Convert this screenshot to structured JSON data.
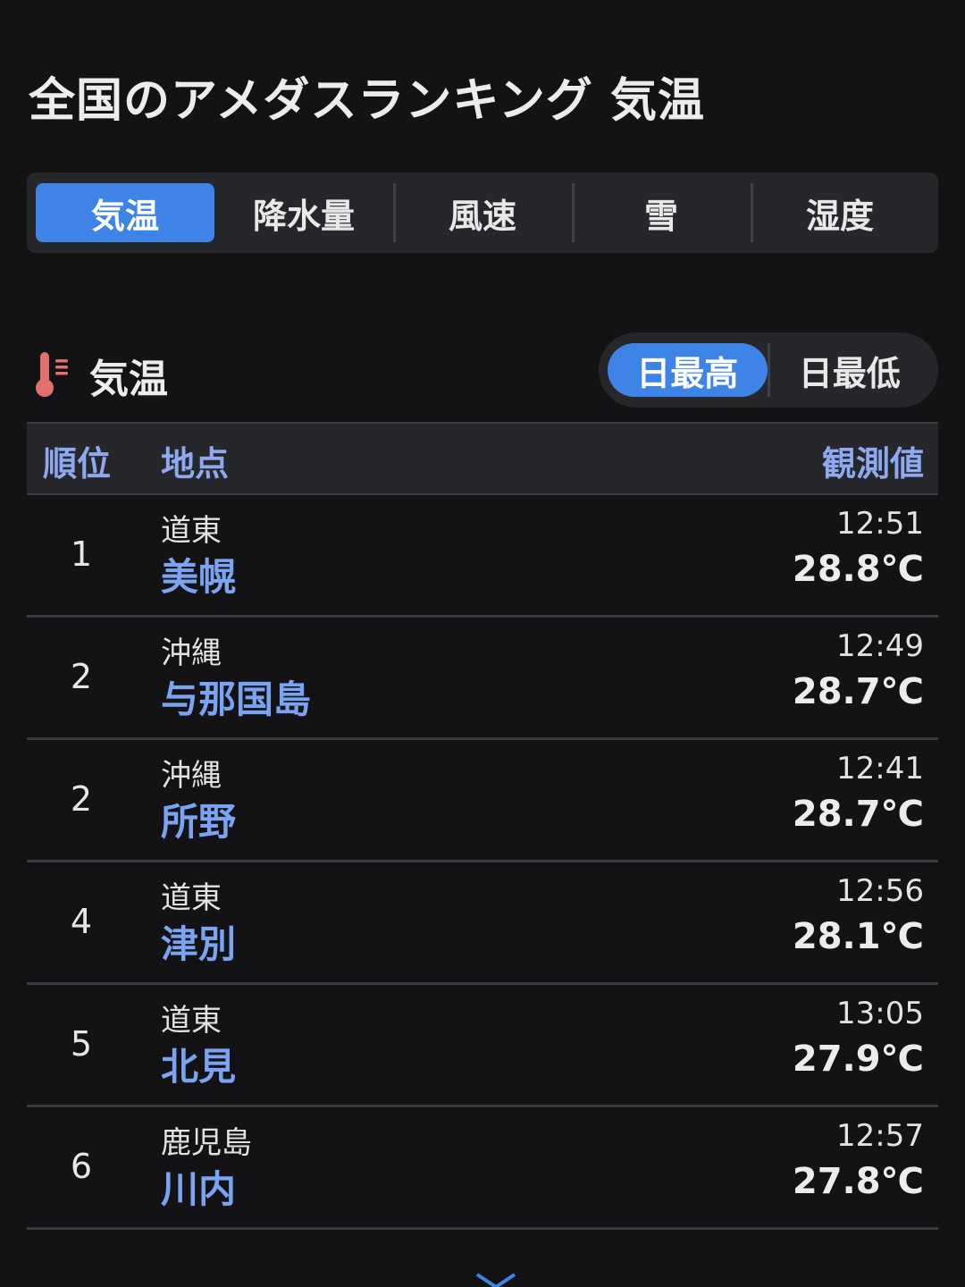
{
  "page": {
    "title": "全国のアメダスランキング 気温"
  },
  "tabs": [
    {
      "label": "気温",
      "active": true
    },
    {
      "label": "降水量",
      "active": false
    },
    {
      "label": "風速",
      "active": false
    },
    {
      "label": "雪",
      "active": false
    },
    {
      "label": "湿度",
      "active": false
    }
  ],
  "section": {
    "icon": "thermometer-icon",
    "title": "気温",
    "toggle": {
      "max_label": "日最高",
      "min_label": "日最低",
      "selected": "日最高"
    }
  },
  "table": {
    "headers": {
      "rank": "順位",
      "place": "地点",
      "value": "観測値"
    },
    "rows": [
      {
        "rank": "1",
        "region": "道東",
        "station": "美幌",
        "time": "12:51",
        "temp": "28.8℃"
      },
      {
        "rank": "2",
        "region": "沖縄",
        "station": "与那国島",
        "time": "12:49",
        "temp": "28.7℃"
      },
      {
        "rank": "2",
        "region": "沖縄",
        "station": "所野",
        "time": "12:41",
        "temp": "28.7℃"
      },
      {
        "rank": "4",
        "region": "道東",
        "station": "津別",
        "time": "12:56",
        "temp": "28.1℃"
      },
      {
        "rank": "5",
        "region": "道東",
        "station": "北見",
        "time": "13:05",
        "temp": "27.9℃"
      },
      {
        "rank": "6",
        "region": "鹿児島",
        "station": "川内",
        "time": "12:57",
        "temp": "27.8℃"
      }
    ]
  },
  "more": {
    "icon": "chevron-down-icon"
  },
  "colors": {
    "background": "#131315",
    "panel": "#26272b",
    "accent": "#3d84e6",
    "link": "#7aa4f2",
    "header_text": "#8ea9ef",
    "thermometer": "#e3706f"
  }
}
